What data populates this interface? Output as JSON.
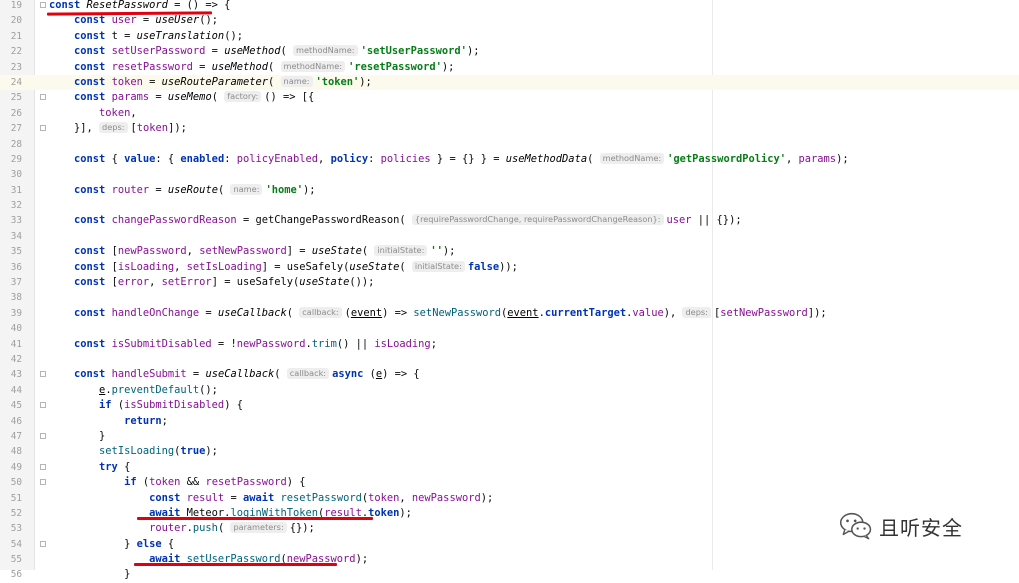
{
  "editor": {
    "current_line": "24",
    "lines": [
      {
        "n": "19",
        "t": [
          [
            "kw",
            "const "
          ],
          [
            "fn-i",
            "ResetPassword"
          ],
          [
            "pl",
            " = () => {"
          ]
        ]
      },
      {
        "n": "20",
        "t": [
          [
            "pl",
            "    "
          ],
          [
            "kw",
            "const "
          ],
          [
            "var",
            "user"
          ],
          [
            "pl",
            " = "
          ],
          [
            "fn-i",
            "useUser"
          ],
          [
            "pl",
            "();"
          ]
        ]
      },
      {
        "n": "21",
        "t": [
          [
            "pl",
            "    "
          ],
          [
            "kw",
            "const "
          ],
          [
            "pl",
            "t = "
          ],
          [
            "fn-i",
            "useTranslation"
          ],
          [
            "pl",
            "();"
          ]
        ]
      },
      {
        "n": "22",
        "t": [
          [
            "pl",
            "    "
          ],
          [
            "kw",
            "const "
          ],
          [
            "var",
            "setUserPassword"
          ],
          [
            "pl",
            " = "
          ],
          [
            "fn-i",
            "useMethod"
          ],
          [
            "pl",
            "( "
          ],
          [
            "hint",
            "methodName:"
          ],
          [
            "str",
            "'setUserPassword'"
          ],
          [
            "pl",
            ");"
          ]
        ]
      },
      {
        "n": "23",
        "t": [
          [
            "pl",
            "    "
          ],
          [
            "kw",
            "const "
          ],
          [
            "var",
            "resetPassword"
          ],
          [
            "pl",
            " = "
          ],
          [
            "fn-i",
            "useMethod"
          ],
          [
            "pl",
            "( "
          ],
          [
            "hint",
            "methodName:"
          ],
          [
            "str",
            "'resetPassword'"
          ],
          [
            "pl",
            ");"
          ]
        ]
      },
      {
        "n": "24",
        "t": [
          [
            "pl",
            "    "
          ],
          [
            "kw",
            "const "
          ],
          [
            "var",
            "token"
          ],
          [
            "pl",
            " = "
          ],
          [
            "fn-i",
            "useRouteParameter"
          ],
          [
            "pl",
            "( "
          ],
          [
            "hint",
            "name:"
          ],
          [
            "str",
            "'token'"
          ],
          [
            "pl",
            ");"
          ]
        ]
      },
      {
        "n": "25",
        "t": [
          [
            "pl",
            "    "
          ],
          [
            "kw",
            "const "
          ],
          [
            "var",
            "params"
          ],
          [
            "pl",
            " = "
          ],
          [
            "fn-i",
            "useMemo"
          ],
          [
            "pl",
            "( "
          ],
          [
            "hint",
            "factory:"
          ],
          [
            "pl",
            "() => [{"
          ]
        ]
      },
      {
        "n": "26",
        "t": [
          [
            "pl",
            "        "
          ],
          [
            "var",
            "token"
          ],
          [
            "pl",
            ","
          ]
        ]
      },
      {
        "n": "27",
        "t": [
          [
            "pl",
            "    }], "
          ],
          [
            "hint",
            "deps:"
          ],
          [
            "pl",
            "["
          ],
          [
            "var",
            "token"
          ],
          [
            "pl",
            "]);"
          ]
        ]
      },
      {
        "n": "28",
        "t": []
      },
      {
        "n": "29",
        "t": [
          [
            "pl",
            "    "
          ],
          [
            "kw",
            "const "
          ],
          [
            "pl",
            "{ "
          ],
          [
            "kw",
            "value"
          ],
          [
            "pl",
            ": { "
          ],
          [
            "kw",
            "enabled"
          ],
          [
            "pl",
            ": "
          ],
          [
            "var",
            "policyEnabled"
          ],
          [
            "pl",
            ", "
          ],
          [
            "kw",
            "policy"
          ],
          [
            "pl",
            ": "
          ],
          [
            "var",
            "policies"
          ],
          [
            "pl",
            " } = {} } = "
          ],
          [
            "fn-i",
            "useMethodData"
          ],
          [
            "pl",
            "( "
          ],
          [
            "hint",
            "methodName:"
          ],
          [
            "str",
            "'getPasswordPolicy'"
          ],
          [
            "pl",
            ", "
          ],
          [
            "var",
            "params"
          ],
          [
            "pl",
            ");"
          ]
        ]
      },
      {
        "n": "30",
        "t": []
      },
      {
        "n": "31",
        "t": [
          [
            "pl",
            "    "
          ],
          [
            "kw",
            "const "
          ],
          [
            "var",
            "router"
          ],
          [
            "pl",
            " = "
          ],
          [
            "fn-i",
            "useRoute"
          ],
          [
            "pl",
            "( "
          ],
          [
            "hint",
            "name:"
          ],
          [
            "str",
            "'home'"
          ],
          [
            "pl",
            ");"
          ]
        ]
      },
      {
        "n": "32",
        "t": []
      },
      {
        "n": "33",
        "t": [
          [
            "pl",
            "    "
          ],
          [
            "kw",
            "const "
          ],
          [
            "var",
            "changePasswordReason"
          ],
          [
            "pl",
            " = getChangePasswordReason( "
          ],
          [
            "hint",
            "{requirePasswordChange, requirePasswordChangeReason}:"
          ],
          [
            "var",
            "user"
          ],
          [
            "pl",
            " || {});"
          ]
        ]
      },
      {
        "n": "34",
        "t": []
      },
      {
        "n": "35",
        "t": [
          [
            "pl",
            "    "
          ],
          [
            "kw",
            "const "
          ],
          [
            "pl",
            "["
          ],
          [
            "var",
            "newPassword"
          ],
          [
            "pl",
            ", "
          ],
          [
            "var",
            "setNewPassword"
          ],
          [
            "pl",
            "] = "
          ],
          [
            "fn-i",
            "useState"
          ],
          [
            "pl",
            "( "
          ],
          [
            "hint",
            "initialState:"
          ],
          [
            "str",
            "''"
          ],
          [
            "pl",
            ");"
          ]
        ]
      },
      {
        "n": "36",
        "t": [
          [
            "pl",
            "    "
          ],
          [
            "kw",
            "const "
          ],
          [
            "pl",
            "["
          ],
          [
            "var",
            "isLoading"
          ],
          [
            "pl",
            ", "
          ],
          [
            "var",
            "setIsLoading"
          ],
          [
            "pl",
            "] = useSafely("
          ],
          [
            "fn-i",
            "useState"
          ],
          [
            "pl",
            "( "
          ],
          [
            "hint",
            "initialState:"
          ],
          [
            "kw",
            "false"
          ],
          [
            "pl",
            "));"
          ]
        ]
      },
      {
        "n": "37",
        "t": [
          [
            "pl",
            "    "
          ],
          [
            "kw",
            "const "
          ],
          [
            "pl",
            "["
          ],
          [
            "var",
            "error"
          ],
          [
            "pl",
            ", "
          ],
          [
            "var",
            "setError"
          ],
          [
            "pl",
            "] = useSafely("
          ],
          [
            "fn-i",
            "useState"
          ],
          [
            "pl",
            "());"
          ]
        ]
      },
      {
        "n": "38",
        "t": []
      },
      {
        "n": "39",
        "t": [
          [
            "pl",
            "    "
          ],
          [
            "kw",
            "const "
          ],
          [
            "var",
            "handleOnChange"
          ],
          [
            "pl",
            " = "
          ],
          [
            "fn-i",
            "useCallback"
          ],
          [
            "pl",
            "( "
          ],
          [
            "hint",
            "callback:"
          ],
          [
            "pl",
            "("
          ],
          [
            "param",
            "event"
          ],
          [
            "pl",
            ") => "
          ],
          [
            "fn",
            "setNewPassword"
          ],
          [
            "pl",
            "("
          ],
          [
            "param",
            "event"
          ],
          [
            "pl",
            "."
          ],
          [
            "kw",
            "currentTarget"
          ],
          [
            "pl",
            "."
          ],
          [
            "var",
            "value"
          ],
          [
            "pl",
            "), "
          ],
          [
            "hint",
            "deps:"
          ],
          [
            "pl",
            "["
          ],
          [
            "var",
            "setNewPassword"
          ],
          [
            "pl",
            "]);"
          ]
        ]
      },
      {
        "n": "40",
        "t": []
      },
      {
        "n": "41",
        "t": [
          [
            "pl",
            "    "
          ],
          [
            "kw",
            "const "
          ],
          [
            "var",
            "isSubmitDisabled"
          ],
          [
            "pl",
            " = !"
          ],
          [
            "var",
            "newPassword"
          ],
          [
            "pl",
            "."
          ],
          [
            "fn",
            "trim"
          ],
          [
            "pl",
            "() || "
          ],
          [
            "var",
            "isLoading"
          ],
          [
            "pl",
            ";"
          ]
        ]
      },
      {
        "n": "42",
        "t": []
      },
      {
        "n": "43",
        "t": [
          [
            "pl",
            "    "
          ],
          [
            "kw",
            "const "
          ],
          [
            "var",
            "handleSubmit"
          ],
          [
            "pl",
            " = "
          ],
          [
            "fn-i",
            "useCallback"
          ],
          [
            "pl",
            "( "
          ],
          [
            "hint",
            "callback:"
          ],
          [
            "kw",
            "async "
          ],
          [
            "pl",
            "("
          ],
          [
            "param",
            "e"
          ],
          [
            "pl",
            ") => {"
          ]
        ]
      },
      {
        "n": "44",
        "t": [
          [
            "pl",
            "        "
          ],
          [
            "param",
            "e"
          ],
          [
            "pl",
            "."
          ],
          [
            "fn",
            "preventDefault"
          ],
          [
            "pl",
            "();"
          ]
        ]
      },
      {
        "n": "45",
        "t": [
          [
            "pl",
            "        "
          ],
          [
            "kw",
            "if "
          ],
          [
            "pl",
            "("
          ],
          [
            "var",
            "isSubmitDisabled"
          ],
          [
            "pl",
            ") {"
          ]
        ]
      },
      {
        "n": "46",
        "t": [
          [
            "pl",
            "            "
          ],
          [
            "kw",
            "return"
          ],
          [
            "pl",
            ";"
          ]
        ]
      },
      {
        "n": "47",
        "t": [
          [
            "pl",
            "        }"
          ]
        ]
      },
      {
        "n": "48",
        "t": [
          [
            "pl",
            "        "
          ],
          [
            "fn",
            "setIsLoading"
          ],
          [
            "pl",
            "("
          ],
          [
            "kw",
            "true"
          ],
          [
            "pl",
            ");"
          ]
        ]
      },
      {
        "n": "49",
        "t": [
          [
            "pl",
            "        "
          ],
          [
            "kw",
            "try "
          ],
          [
            "pl",
            "{"
          ]
        ]
      },
      {
        "n": "50",
        "t": [
          [
            "pl",
            "            "
          ],
          [
            "kw",
            "if "
          ],
          [
            "pl",
            "("
          ],
          [
            "var",
            "token"
          ],
          [
            "pl",
            " && "
          ],
          [
            "var",
            "resetPassword"
          ],
          [
            "pl",
            ") {"
          ]
        ]
      },
      {
        "n": "51",
        "t": [
          [
            "pl",
            "                "
          ],
          [
            "kw",
            "const "
          ],
          [
            "var",
            "result"
          ],
          [
            "pl",
            " = "
          ],
          [
            "kw",
            "await "
          ],
          [
            "fn",
            "resetPassword"
          ],
          [
            "pl",
            "("
          ],
          [
            "var",
            "token"
          ],
          [
            "pl",
            ", "
          ],
          [
            "var",
            "newPassword"
          ],
          [
            "pl",
            ");"
          ]
        ]
      },
      {
        "n": "52",
        "t": [
          [
            "pl",
            "                "
          ],
          [
            "kw",
            "await "
          ],
          [
            "pl",
            "Meteor."
          ],
          [
            "fn",
            "loginWithToken"
          ],
          [
            "pl",
            "("
          ],
          [
            "var",
            "result"
          ],
          [
            "pl",
            "."
          ],
          [
            "kw",
            "token"
          ],
          [
            "pl",
            ");"
          ]
        ]
      },
      {
        "n": "53",
        "t": [
          [
            "pl",
            "                "
          ],
          [
            "var",
            "router"
          ],
          [
            "pl",
            "."
          ],
          [
            "fn",
            "push"
          ],
          [
            "pl",
            "( "
          ],
          [
            "hint",
            "parameters:"
          ],
          [
            "pl",
            "{});"
          ]
        ]
      },
      {
        "n": "54",
        "t": [
          [
            "pl",
            "            } "
          ],
          [
            "kw",
            "else "
          ],
          [
            "pl",
            "{"
          ]
        ]
      },
      {
        "n": "55",
        "t": [
          [
            "pl",
            "                "
          ],
          [
            "kw",
            "await "
          ],
          [
            "fn",
            "setUserPassword"
          ],
          [
            "pl",
            "("
          ],
          [
            "var",
            "newPassword"
          ],
          [
            "pl",
            ");"
          ]
        ]
      },
      {
        "n": "56",
        "t": [
          [
            "pl",
            "            }"
          ]
        ]
      }
    ]
  },
  "watermark": {
    "text": "且听安全",
    "icon": "wechat-icon",
    "color": "#333333"
  },
  "annotations": {
    "underline_color": "#e0000e"
  }
}
